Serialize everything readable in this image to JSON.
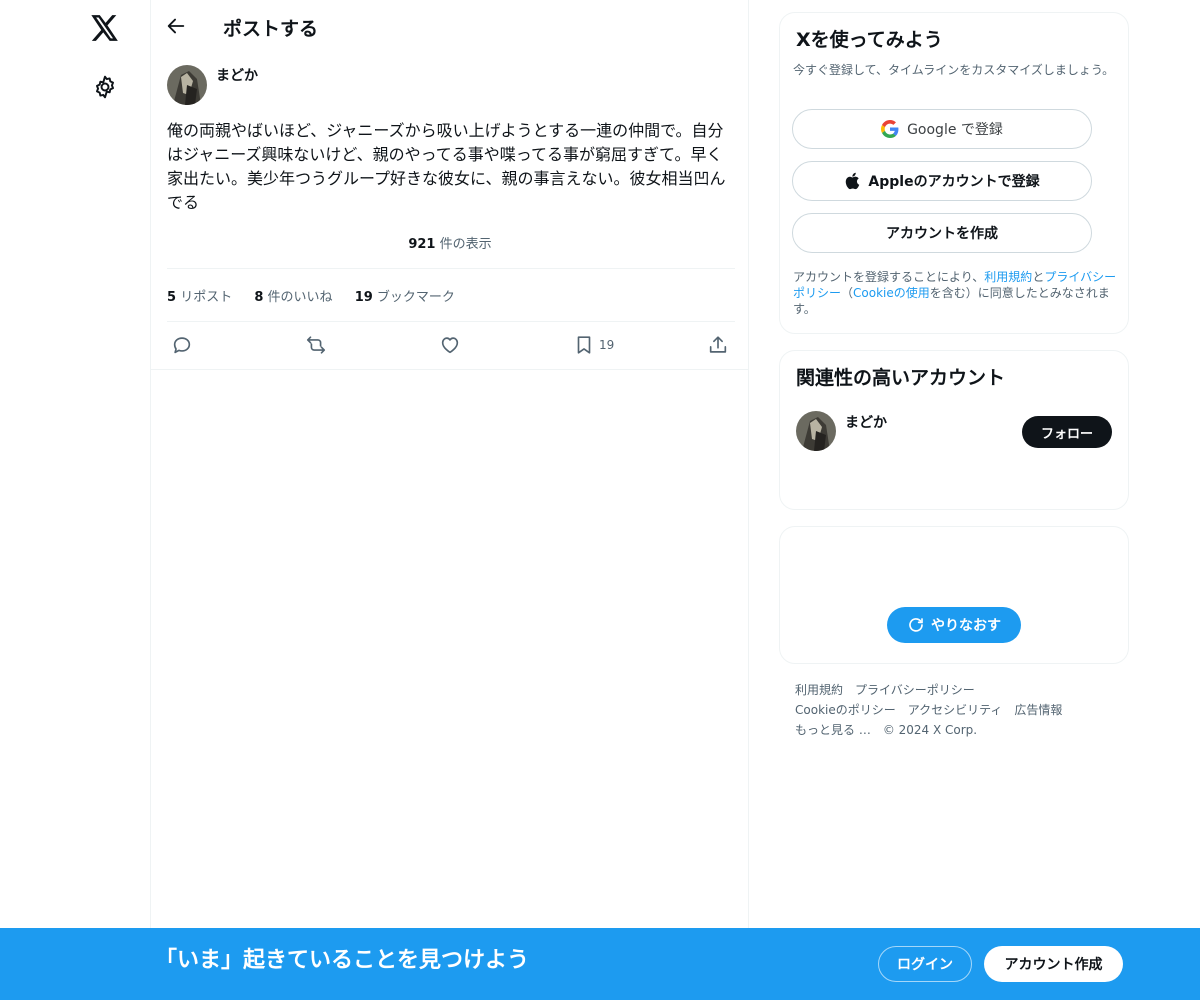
{
  "nav": {
    "logo_icon": "x-logo-icon",
    "settings_icon": "gear-icon"
  },
  "header": {
    "back_icon": "arrow-left-icon",
    "title": "ポストする"
  },
  "post": {
    "author_name": "まどか",
    "text": "俺の両親やばいほど、ジャニーズから吸い上げようとする一連の仲間で。自分はジャニーズ興味ないけど、親のやってる事や喋ってる事が窮屈すぎて。早く家出たい。美少年つうグループ好きな彼女に、親の事言えない。彼女相当凹んでる",
    "views_count": "921",
    "views_label": "件の表示",
    "reposts_count": "5",
    "reposts_label": "リポスト",
    "likes_count": "8",
    "likes_label": "件のいいね",
    "bookmarks_count": "19",
    "bookmarks_label": "ブックマーク",
    "actions": {
      "bookmark_count": "19"
    }
  },
  "signup_card": {
    "title": "Xを使ってみよう",
    "subtitle": "今すぐ登録して、タイムラインをカスタマイズしましょう。",
    "google_label": "Google で登録",
    "apple_label": "Appleのアカウントで登録",
    "create_label": "アカウントを作成",
    "legal_prefix": "アカウントを登録することにより、",
    "legal_terms": "利用規約",
    "legal_and": "と",
    "legal_privacy": "プライバシーポリシー",
    "legal_paren_open": "（",
    "legal_cookie": "Cookieの使用",
    "legal_suffix": "を含む）に同意したとみなされます。"
  },
  "related_card": {
    "title": "関連性の高いアカウント",
    "account_name": "まどか",
    "follow_label": "フォロー"
  },
  "trends_card": {
    "retry_label": "やりなおす"
  },
  "footer": {
    "terms": "利用規約",
    "privacy": "プライバシーポリシー",
    "cookie": "Cookieのポリシー",
    "accessibility": "アクセシビリティ",
    "ads": "広告情報",
    "more": "もっと見る …",
    "copyright": "© 2024 X Corp."
  },
  "banner": {
    "text": "「いま」起きていることを見つけよう",
    "login_label": "ログイン",
    "signup_label": "アカウント作成"
  },
  "colors": {
    "accent": "#1d9bf0",
    "text_primary": "#0f1419",
    "text_secondary": "#536471",
    "border": "#eff3f4"
  }
}
